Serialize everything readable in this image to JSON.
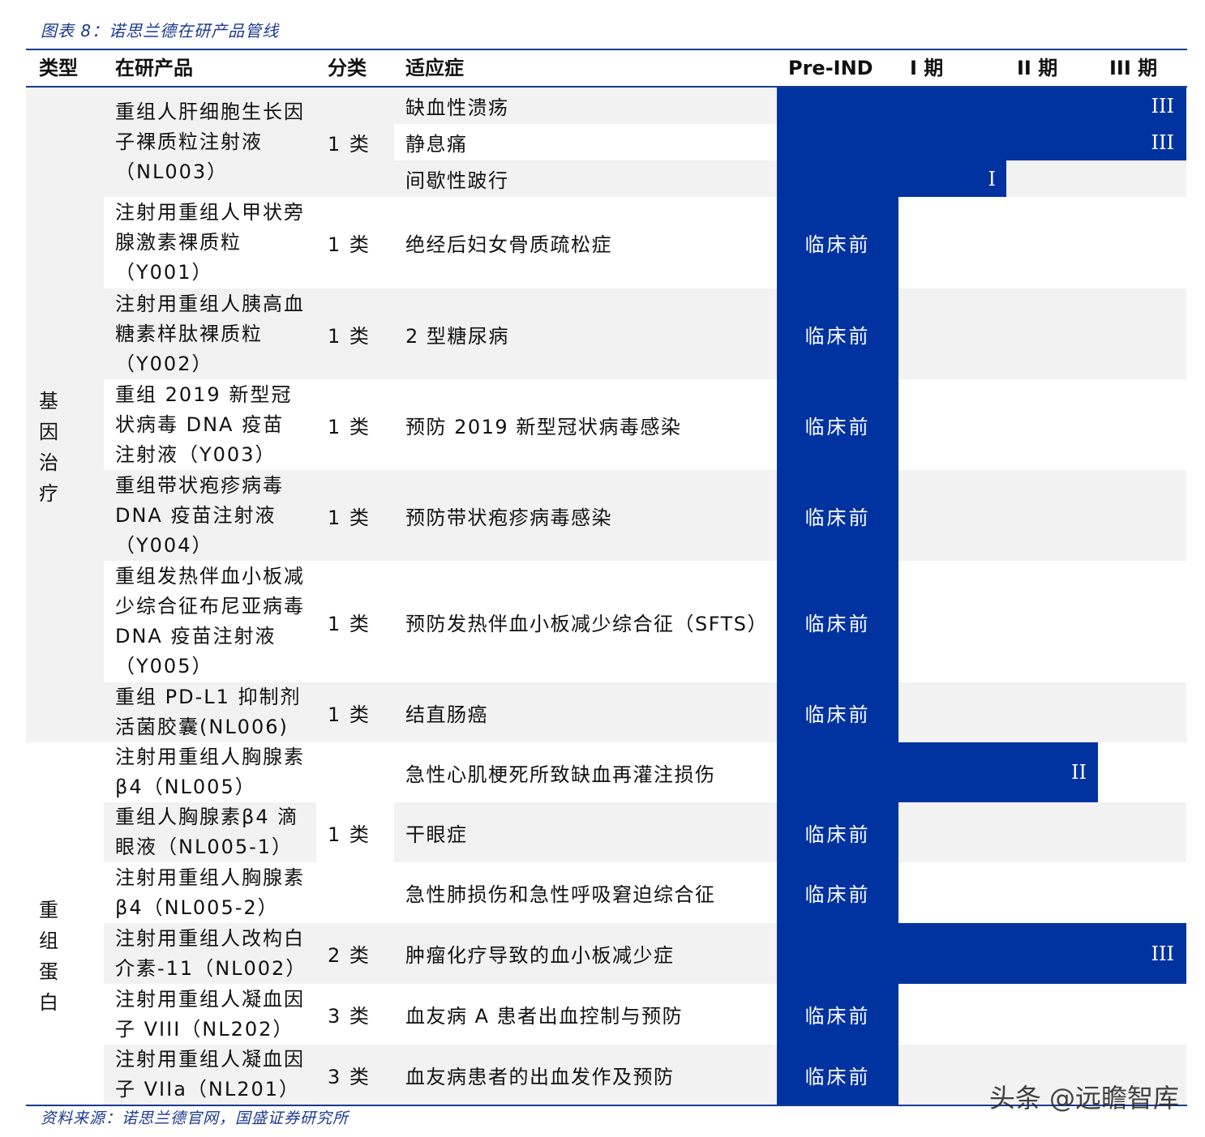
{
  "caption": "图表 8：诺思兰德在研产品管线",
  "source": "资料来源：诺思兰德官网，国盛证券研究所",
  "watermark": "头条 @远瞻智库",
  "headers": {
    "type": "类型",
    "product": "在研产品",
    "class": "分类",
    "indication": "适应症",
    "pre_ind": "Pre-IND",
    "phase1": "I 期",
    "phase2": "II 期",
    "phase3": "III 期"
  },
  "types": {
    "gene_therapy": "基 因 治疗",
    "recombinant_protein": "重 组 蛋白"
  },
  "stage_colors": {
    "bar": "#0033a0",
    "band": "#f2f2f2",
    "rule": "#1b3a8f"
  },
  "rows": [
    {
      "product": "重组人肝细胞生长因子裸质粒注射液（NL003）",
      "class": "1 类",
      "indications": [
        {
          "name": "缺血性溃疡",
          "stage": "III"
        },
        {
          "name": "静息痛",
          "stage": "III"
        },
        {
          "name": "间歇性跛行",
          "stage": "I"
        }
      ]
    },
    {
      "product": "注射用重组人甲状旁腺激素裸质粒（Y001）",
      "class": "1 类",
      "indications": [
        {
          "name": "绝经后妇女骨质疏松症",
          "stage": "临床前"
        }
      ]
    },
    {
      "product": "注射用重组人胰高血糖素样肽裸质粒（Y002）",
      "class": "1 类",
      "indications": [
        {
          "name": "2 型糖尿病",
          "stage": "临床前"
        }
      ]
    },
    {
      "product": "重组 2019 新型冠状病毒 DNA 疫苗注射液（Y003）",
      "class": "1 类",
      "indications": [
        {
          "name": "预防 2019 新型冠状病毒感染",
          "stage": "临床前"
        }
      ]
    },
    {
      "product": "重组带状疱疹病毒 DNA 疫苗注射液（Y004）",
      "class": "1 类",
      "indications": [
        {
          "name": "预防带状疱疹病毒感染",
          "stage": "临床前"
        }
      ]
    },
    {
      "product": "重组发热伴血小板减少综合征布尼亚病毒 DNA 疫苗注射液（Y005）",
      "class": "1 类",
      "indications": [
        {
          "name": "预防发热伴血小板减少综合征（SFTS）",
          "stage": "临床前"
        }
      ]
    },
    {
      "product": "重组 PD-L1 抑制剂活菌胶囊(NL006)",
      "class": "1 类",
      "indications": [
        {
          "name": "结直肠癌",
          "stage": "临床前"
        }
      ]
    },
    {
      "product": "注射用重组人胸腺素β4（NL005）",
      "class": "",
      "indications": [
        {
          "name": "急性心肌梗死所致缺血再灌注损伤",
          "stage": "II"
        }
      ]
    },
    {
      "product": "重组人胸腺素β4 滴眼液（NL005-1）",
      "class": "1 类",
      "indications": [
        {
          "name": "干眼症",
          "stage": "临床前"
        }
      ]
    },
    {
      "product": "注射用重组人胸腺素β4（NL005-2）",
      "class": "",
      "indications": [
        {
          "name": "急性肺损伤和急性呼吸窘迫综合征",
          "stage": "临床前"
        }
      ]
    },
    {
      "product": "注射用重组人改构白介素-11（NL002）",
      "class": "2 类",
      "indications": [
        {
          "name": "肿瘤化疗导致的血小板减少症",
          "stage": "III"
        }
      ]
    },
    {
      "product": "注射用重组人凝血因子 VIII（NL202）",
      "class": "3 类",
      "indications": [
        {
          "name": "血友病 A 患者出血控制与预防",
          "stage": "临床前"
        }
      ]
    },
    {
      "product": "注射用重组人凝血因子 VIIa（NL201）",
      "class": "3 类",
      "indications": [
        {
          "name": "血友病患者的出血发作及预防",
          "stage": "临床前"
        }
      ]
    }
  ]
}
